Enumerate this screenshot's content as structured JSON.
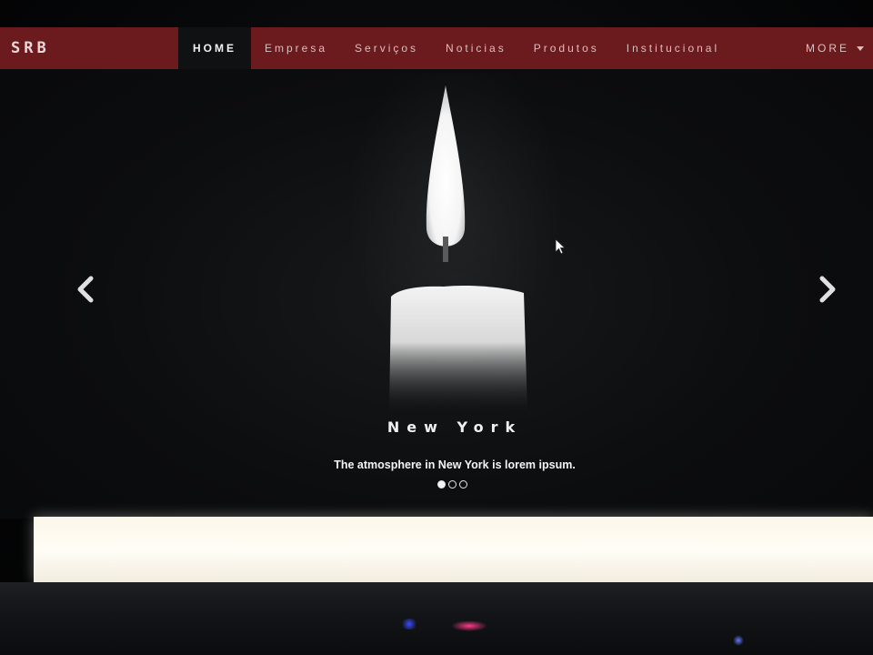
{
  "navbar": {
    "brand": "SRB",
    "items": [
      {
        "label": "HOME",
        "active": true
      },
      {
        "label": "Empresa"
      },
      {
        "label": "Serviços"
      },
      {
        "label": "Noticias"
      },
      {
        "label": "Produtos"
      },
      {
        "label": "Institucional"
      }
    ],
    "more_label": "MORE"
  },
  "carousel": {
    "slide_title": "New York",
    "slide_text": "The atmosphere in New York is lorem ipsum.",
    "slide_count": 3,
    "active_index": 0,
    "prev_icon": "chevron-left-icon",
    "next_icon": "chevron-right-icon"
  },
  "colors": {
    "navbar_bg": "#6b1a1d",
    "active_nav_bg": "#101113",
    "page_bg": "#0c0d0f"
  }
}
